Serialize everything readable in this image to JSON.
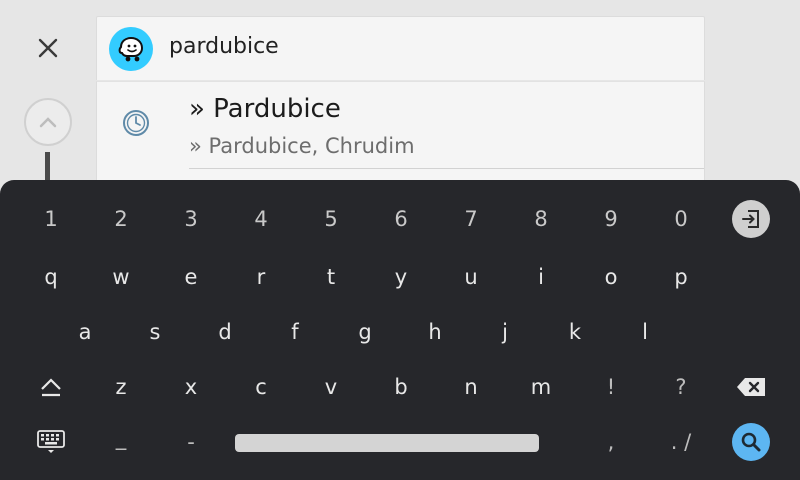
{
  "search": {
    "query": "pardubice"
  },
  "result": {
    "title": "» Pardubice",
    "subtitle": "» Pardubice, Chrudim"
  },
  "keyboard": {
    "row_numbers": [
      "1",
      "2",
      "3",
      "4",
      "5",
      "6",
      "7",
      "8",
      "9",
      "0"
    ],
    "row_top": [
      "q",
      "w",
      "e",
      "r",
      "t",
      "y",
      "u",
      "i",
      "o",
      "p"
    ],
    "row_home": [
      "a",
      "s",
      "d",
      "f",
      "g",
      "h",
      "j",
      "k",
      "l"
    ],
    "row_bottom": [
      "z",
      "x",
      "c",
      "v",
      "b",
      "n",
      "m",
      "!",
      "?"
    ],
    "underscore": "_",
    "dash": "-",
    "comma": ",",
    "period_slash": ". /"
  },
  "colors": {
    "waze_blue": "#33ccff",
    "search_key_blue": "#5db6f2",
    "keyboard_bg": "#26272b"
  },
  "icons": {
    "close": "close-icon",
    "up": "chevron-up-icon",
    "logo": "waze-logo-icon",
    "history": "clock-icon",
    "exit_keyboard": "exit-keyboard-icon",
    "shift": "shift-icon",
    "backspace": "backspace-icon",
    "keyboard_switch": "keyboard-icon",
    "search": "search-icon"
  }
}
